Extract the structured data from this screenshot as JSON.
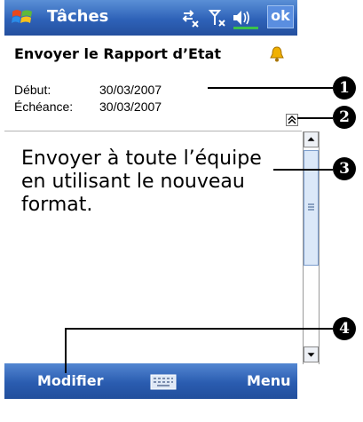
{
  "titlebar": {
    "app_title": "Tâches",
    "ok_label": "ok",
    "icons": [
      "windows-start-icon",
      "connectivity-icon",
      "signal-icon",
      "volume-icon"
    ]
  },
  "task": {
    "title": "Envoyer le Rapport d’Etat",
    "start_label": "Début:",
    "start_value": "30/03/2007",
    "due_label": "Échéance:",
    "due_value": "30/03/2007",
    "note": "Envoyer à toute l’équipe en utilisant le nouveau format."
  },
  "menubar": {
    "left_label": "Modifier",
    "right_label": "Menu"
  },
  "callouts": [
    "1",
    "2",
    "3",
    "4"
  ],
  "colors": {
    "bar_blue": "#2e62b8",
    "ok_button": "#5a8ee0",
    "alarm_bell": "#f0b000"
  }
}
